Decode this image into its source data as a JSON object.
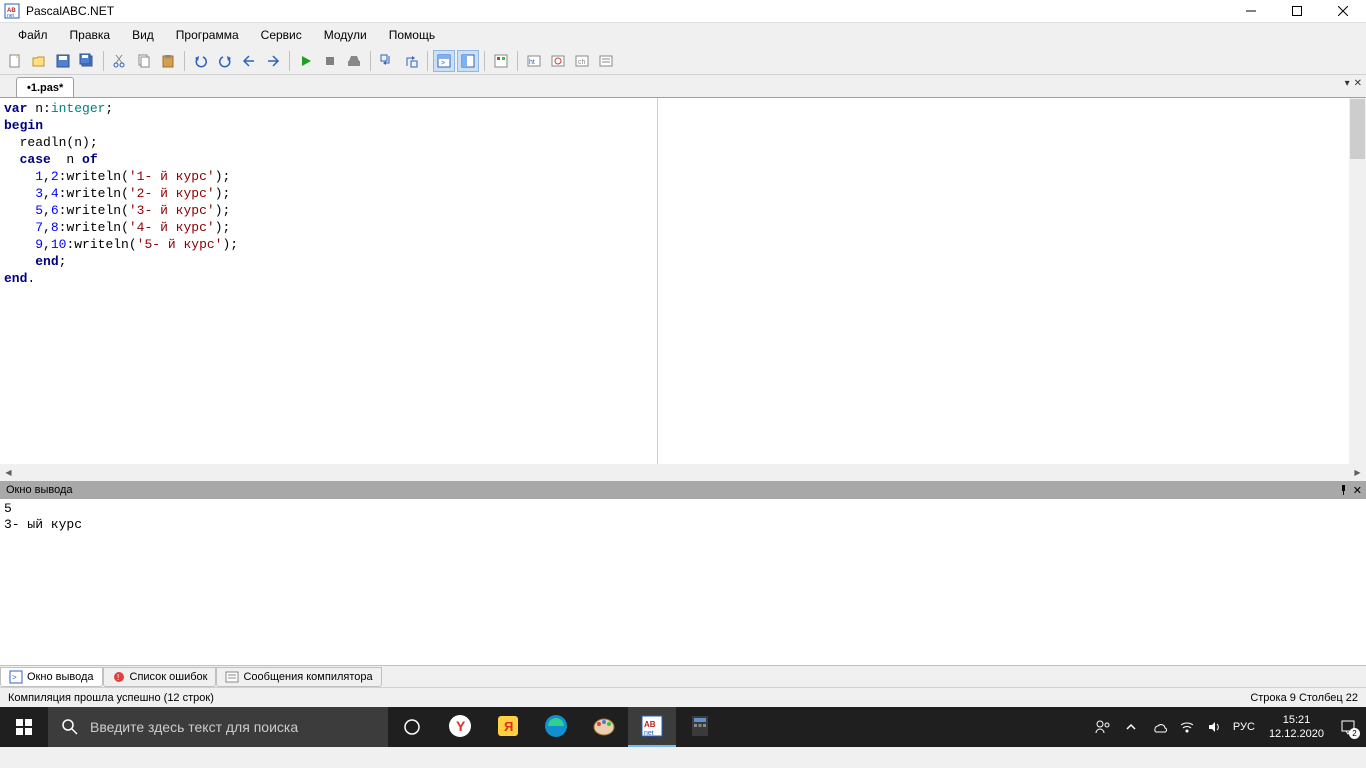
{
  "titlebar": {
    "title": "PascalABC.NET"
  },
  "menu": {
    "items": [
      "Файл",
      "Правка",
      "Вид",
      "Программа",
      "Сервис",
      "Модули",
      "Помощь"
    ]
  },
  "tabs": {
    "active": "•1.pas*"
  },
  "code": {
    "lines": [
      {
        "t": "var",
        "p": " n:",
        "kw": "var",
        "typ": "integer",
        "rest": ";"
      },
      {
        "kw": "begin"
      },
      {
        "indent": "  ",
        "call": "readln(n);"
      },
      {
        "indent": "  ",
        "kw": "case",
        "rest": "  n ",
        "kw2": "of"
      },
      {
        "indent": "    ",
        "nums": "1,2",
        "call": ":writeln(",
        "str": "'1- й курс'",
        "end": ");"
      },
      {
        "indent": "    ",
        "nums": "3,4",
        "call": ":writeln(",
        "str": "'2- й курс'",
        "end": ");"
      },
      {
        "indent": "    ",
        "nums": "5,6",
        "call": ":writeln(",
        "str": "'3- й курс'",
        "end": ");"
      },
      {
        "indent": "    ",
        "nums": "7,8",
        "call": ":writeln(",
        "str": "'4- й курс'",
        "end": ");"
      },
      {
        "indent": "    ",
        "nums": "9,10",
        "call": ":writeln(",
        "str": "'5- й курс'",
        "end": ");"
      },
      {
        "indent": "    ",
        "kw": "end",
        "rest": ";"
      },
      {
        "kw": "end",
        "rest": "."
      }
    ]
  },
  "output": {
    "title": "Окно вывода",
    "text": "5\n3- ый курс"
  },
  "bottom_tabs": {
    "t1": "Окно вывода",
    "t2": "Список ошибок",
    "t3": "Сообщения компилятора"
  },
  "status": {
    "left": "Компиляция прошла успешно (12 строк)",
    "right": "Строка  9  Столбец  22"
  },
  "taskbar": {
    "search_placeholder": "Введите здесь текст для поиска",
    "lang": "РУС",
    "time": "15:21",
    "date": "12.12.2020",
    "notif_count": "2"
  }
}
